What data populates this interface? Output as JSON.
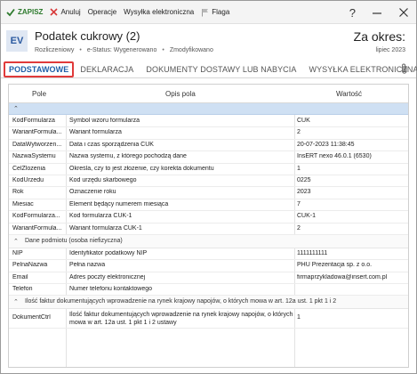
{
  "toolbar": {
    "save_label": "ZAPISZ",
    "cancel_label": "Anuluj",
    "operations_label": "Operacje",
    "send_label": "Wysyłka elektroniczna",
    "flag_label": "Flaga",
    "help_symbol": "?",
    "colors": {
      "save": "#2d7a2d",
      "cancel": "#d83a3a",
      "flag": "#999999"
    }
  },
  "header": {
    "badge": "EV",
    "title": "Podatek cukrowy (2)",
    "status_1": "Rozliczeniowy",
    "status_2": "e-Status: Wygenerowano",
    "status_3": "Zmodyfikowano",
    "period_label": "Za okres:",
    "period_value": "lipiec 2023"
  },
  "tabs": [
    {
      "label": "PODSTAWOWE",
      "active": true
    },
    {
      "label": "DEKLARACJA",
      "active": false
    },
    {
      "label": "DOKUMENTY DOSTAWY LUB NABYCIA",
      "active": false
    },
    {
      "label": "WYSYŁKA ELEKTRONICZNA",
      "active": false
    }
  ],
  "grid": {
    "columns": [
      "Pole",
      "Opis pola",
      "Wartość"
    ],
    "rows_1": [
      {
        "pole": "KodFormularza",
        "opis": "Symbol wzoru formularza",
        "wartosc": "CUK"
      },
      {
        "pole": "WariantFormula...",
        "opis": "Wariant formularza",
        "wartosc": "2"
      },
      {
        "pole": "DataWytworzen...",
        "opis": "Data i czas sporządzenia CUK",
        "wartosc": "20-07-2023 11:38:45"
      },
      {
        "pole": "NazwaSystemu",
        "opis": "Nazwa systemu, z którego pochodzą dane",
        "wartosc": "InsERT nexo 46.0.1 (6530)"
      },
      {
        "pole": "CelZlozenia",
        "opis": "Określa, czy to jest złożenie, czy korekta dokumentu",
        "wartosc": "1"
      },
      {
        "pole": "KodUrzedu",
        "opis": "Kod urzędu skarbowego",
        "wartosc": "0225"
      },
      {
        "pole": "Rok",
        "opis": "Oznaczenie roku",
        "wartosc": "2023"
      },
      {
        "pole": "Miesiac",
        "opis": "Element będący numerem miesiąca",
        "wartosc": "7"
      },
      {
        "pole": "KodFormularza...",
        "opis": "Kod formularza CUK-1",
        "wartosc": "CUK-1"
      },
      {
        "pole": "WariantFormula...",
        "opis": "Wariant formularza CUK-1",
        "wartosc": "2"
      }
    ],
    "group_2": "Dane podmiotu (osoba niefizyczna)",
    "rows_2": [
      {
        "pole": "NIP",
        "opis": "Identyfikator podatkowy NIP",
        "wartosc": "1111111111"
      },
      {
        "pole": "PelnaNazwa",
        "opis": "Pełna nazwa",
        "wartosc": "PHU Prezentacja sp. z o.o."
      },
      {
        "pole": "Email",
        "opis": "Adres poczty elektronicznej",
        "wartosc": "firmaprzykladowa@insert.com.pl"
      },
      {
        "pole": "Telefon",
        "opis": "Numer telefonu kontaktowego",
        "wartosc": ""
      }
    ],
    "group_3": "Ilość faktur dokumentujących wprowadzenie na rynek krajowy napojów, o których mowa w art. 12a ust. 1 pkt 1 i 2",
    "rows_3": [
      {
        "pole": "DokumentCtrl",
        "opis": "Ilość faktur dokumentujących wprowadzenie na rynek krajowy napojów, o których mowa w art. 12a ust. 1 pkt 1 i 2 ustawy",
        "wartosc": "1"
      }
    ]
  }
}
